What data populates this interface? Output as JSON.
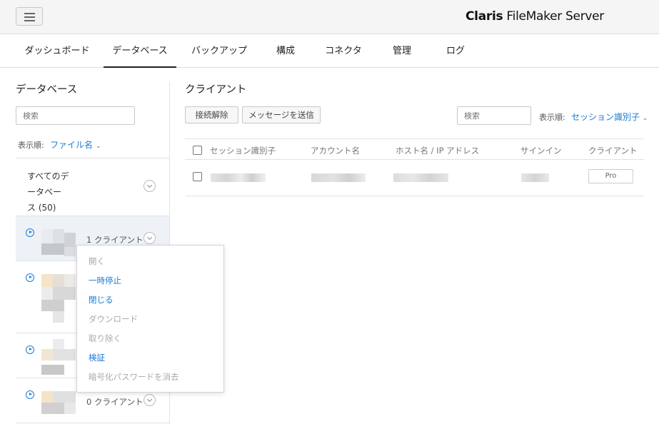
{
  "app": {
    "brand_bold": "Claris",
    "brand_rest": " FileMaker Server"
  },
  "nav": {
    "tabs": [
      {
        "label": "ダッシュボード",
        "active": false
      },
      {
        "label": "データベース",
        "active": true
      },
      {
        "label": "バックアップ",
        "active": false
      },
      {
        "label": "構成",
        "active": false
      },
      {
        "label": "コネクタ",
        "active": false
      },
      {
        "label": "管理",
        "active": false
      },
      {
        "label": "ログ",
        "active": false
      }
    ]
  },
  "databases": {
    "title": "データベース",
    "search_placeholder": "検索",
    "sort_label": "表示順:",
    "sort_value": "ファイル名",
    "all_line1": "すべてのデ",
    "all_line2": "ータベー",
    "all_line3": "ス (50)",
    "items": [
      {
        "client_count": "1 クライアント"
      },
      {
        "client_count": ""
      },
      {
        "client_count": ""
      },
      {
        "client_count": "0 クライアント"
      }
    ]
  },
  "menu": {
    "items": [
      {
        "label": "開く",
        "enabled": false
      },
      {
        "label": "一時停止",
        "enabled": true
      },
      {
        "label": "閉じる",
        "enabled": true
      },
      {
        "label": "ダウンロード",
        "enabled": false
      },
      {
        "label": "取り除く",
        "enabled": false
      },
      {
        "label": "検証",
        "enabled": true
      },
      {
        "label": "暗号化パスワードを消去",
        "enabled": false
      }
    ]
  },
  "clients": {
    "title": "クライアント",
    "disconnect_label": "接続解除",
    "send_message_label": "メッセージを送信",
    "search_placeholder": "検索",
    "sort_label": "表示順:",
    "sort_value": "セッション識別子",
    "columns": [
      "セッション識別子",
      "アカウント名",
      "ホスト名 / IP アドレス",
      "サインイン",
      "クライアント"
    ],
    "rows": [
      {
        "client_type": "Pro"
      }
    ]
  },
  "colors": {
    "accent": "#1a7bd6",
    "disabled_text": "#aaaaaa"
  },
  "icons": [
    "menu-icon",
    "play-circle-icon",
    "chevron-down-icon",
    "checkbox-icon"
  ]
}
